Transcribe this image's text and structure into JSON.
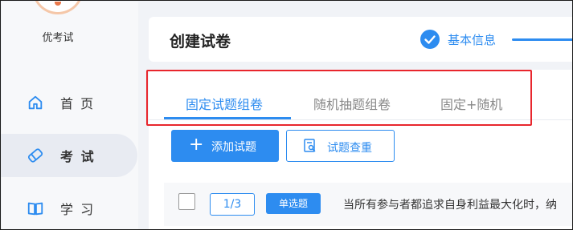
{
  "app": {
    "name": "优考试"
  },
  "sidebar": {
    "items": [
      {
        "label": "首 页",
        "icon": "home-icon",
        "active": false
      },
      {
        "label": "考 试",
        "icon": "tag-icon",
        "active": true
      },
      {
        "label": "学 习",
        "icon": "book-icon",
        "active": false
      }
    ]
  },
  "header": {
    "title": "创建试卷",
    "step": {
      "label": "基本信息",
      "icon": "check-circle-icon"
    }
  },
  "tabs": [
    {
      "label": "固定试题组卷",
      "active": true
    },
    {
      "label": "随机抽题组卷",
      "active": false
    },
    {
      "label": "固定+随机",
      "active": false
    }
  ],
  "toolbar": {
    "add_label": "添加试题",
    "add_icon": "plus-icon",
    "dedupe_label": "试题查重",
    "dedupe_icon": "document-search-icon"
  },
  "question": {
    "index": "1/3",
    "type": "单选题",
    "text": "当所有参与者都追求自身利益最大化时，纳"
  },
  "colors": {
    "accent": "#2d8cf0",
    "highlight": "#e8262d",
    "background": "#f1f3f7"
  }
}
